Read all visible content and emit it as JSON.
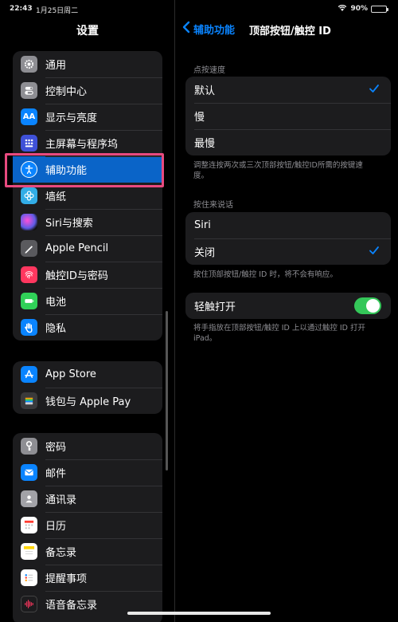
{
  "status": {
    "time": "22:43",
    "date": "1月25日周二",
    "battery": "90%",
    "battery_level": 0.9
  },
  "sidebar": {
    "title": "设置",
    "groups": [
      {
        "items": [
          {
            "label": "通用",
            "icon": "gear-icon",
            "color": "#8e8e93"
          },
          {
            "label": "控制中心",
            "icon": "switches-icon",
            "color": "#8e8e93"
          },
          {
            "label": "显示与亮度",
            "icon": "text-size-icon",
            "color": "#0a84ff"
          },
          {
            "label": "主屏幕与程序坞",
            "icon": "home-grid-icon",
            "color": "#3f51d8"
          },
          {
            "label": "辅助功能",
            "icon": "accessibility-icon",
            "color": "#0a84ff",
            "selected": true
          },
          {
            "label": "墙纸",
            "icon": "wallpaper-flower-icon",
            "color": "#32ade6"
          },
          {
            "label": "Siri与搜索",
            "icon": "siri-icon",
            "color": "#3a3a6a"
          },
          {
            "label": "Apple Pencil",
            "icon": "pencil-icon",
            "color": "#5a5a5e"
          },
          {
            "label": "触控ID与密码",
            "icon": "fingerprint-icon",
            "color": "#ff375f"
          },
          {
            "label": "电池",
            "icon": "battery-icon",
            "color": "#30d158"
          },
          {
            "label": "隐私",
            "icon": "hand-icon",
            "color": "#0a84ff"
          }
        ]
      },
      {
        "items": [
          {
            "label": "App Store",
            "icon": "app-store-icon",
            "color": "#0a84ff"
          },
          {
            "label": "钱包与 Apple Pay",
            "icon": "wallet-icon",
            "color": "#3a3a3c"
          }
        ]
      },
      {
        "items": [
          {
            "label": "密码",
            "icon": "key-icon",
            "color": "#8e8e93"
          },
          {
            "label": "邮件",
            "icon": "mail-icon",
            "color": "#0a84ff"
          },
          {
            "label": "通讯录",
            "icon": "contacts-icon",
            "color": "#a2a2a7"
          },
          {
            "label": "日历",
            "icon": "calendar-icon",
            "color": "#ffffff"
          },
          {
            "label": "备忘录",
            "icon": "notes-icon",
            "color": "#ffd60a"
          },
          {
            "label": "提醒事项",
            "icon": "reminders-icon",
            "color": "#ffffff"
          },
          {
            "label": "语音备忘录",
            "icon": "voice-memo-icon",
            "color": "#1c1c1e"
          }
        ]
      }
    ]
  },
  "detail": {
    "back_label": "辅助功能",
    "title": "顶部按钮/触控 ID",
    "click_speed": {
      "header": "点按速度",
      "options": [
        "默认",
        "慢",
        "最慢"
      ],
      "selected": "默认",
      "footer": "调整连按两次或三次顶部按钮/触控ID所需的按键速度。"
    },
    "press_to_speak": {
      "header": "按住来说话",
      "options": [
        "Siri",
        "关闭"
      ],
      "selected": "关闭",
      "footer": "按住顶部按钮/触控 ID 时，将不会有响应。"
    },
    "rest_finger": {
      "label": "轻触打开",
      "on": true,
      "footer": "将手指放在顶部按钮/触控 ID 上以通过触控 ID 打开 iPad。"
    }
  },
  "accent_color": "#0a84ff",
  "highlight_color": "#e84a7f"
}
